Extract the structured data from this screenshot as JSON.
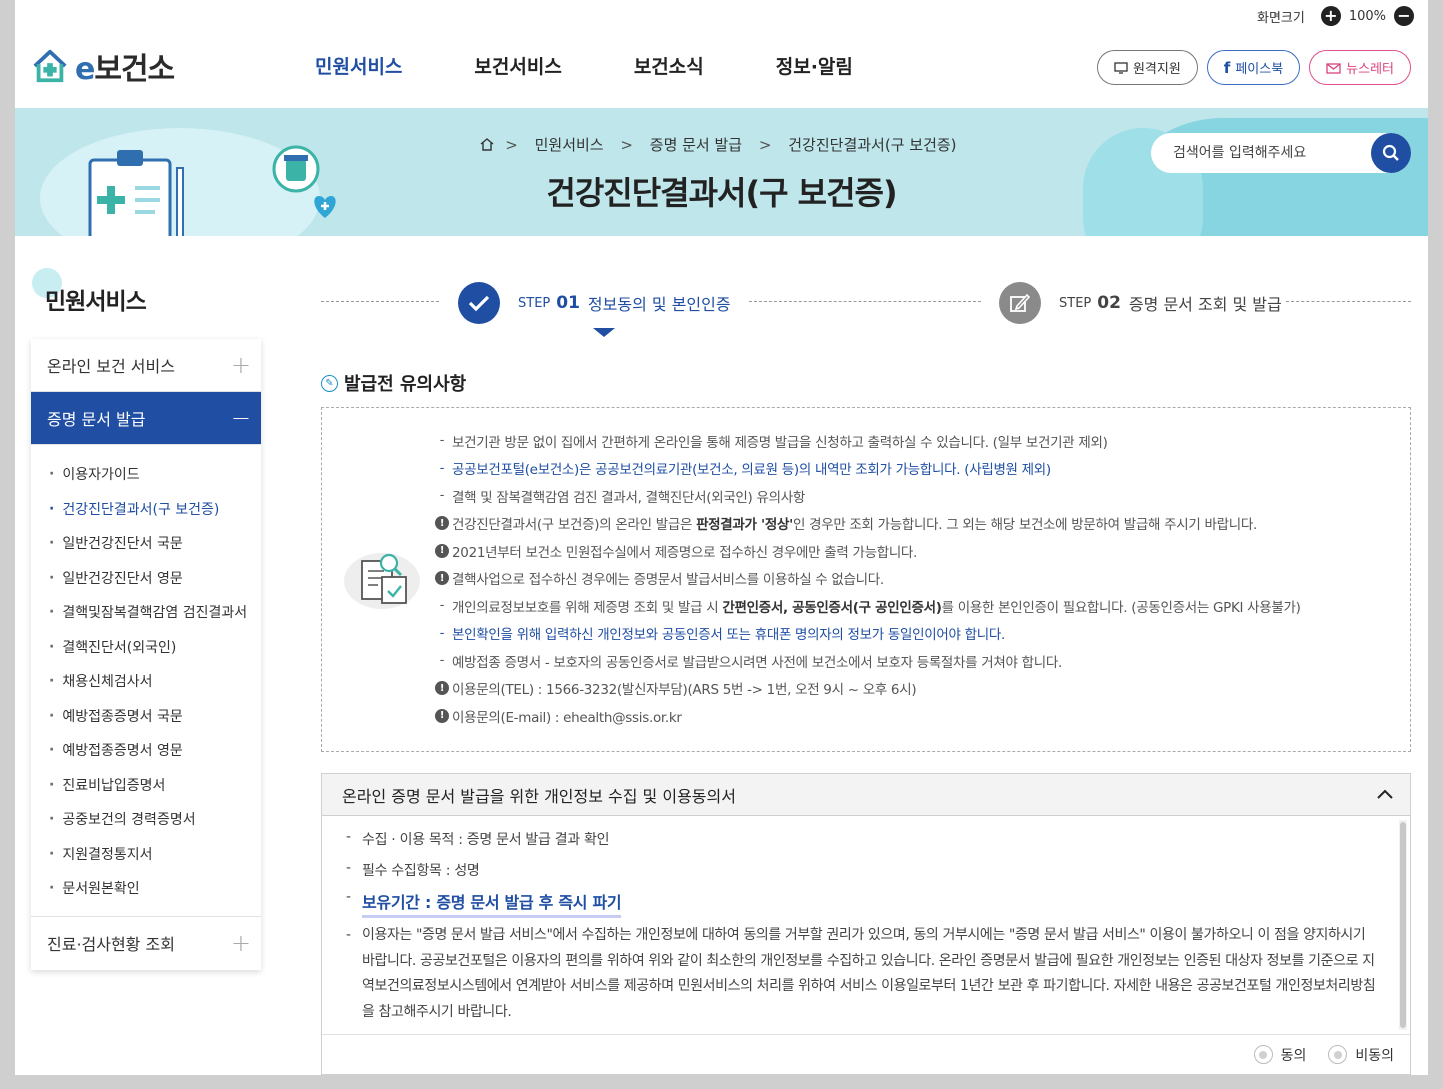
{
  "util": {
    "screen_size_label": "화면크기",
    "zoom": "100%",
    "plus": "+",
    "minus": "−"
  },
  "logo": {
    "e": "e",
    "text": "보건소"
  },
  "gnb": [
    "민원서비스",
    "보건서비스",
    "보건소식",
    "정보·알림"
  ],
  "header_buttons": {
    "remote": "원격지원",
    "facebook": "페이스북",
    "newsletter": "뉴스레터"
  },
  "breadcrumb": [
    "민원서비스",
    "증명 문서 발급",
    "건강진단결과서(구 보건증)"
  ],
  "page_title": "건강진단결과서(구 보건증)",
  "search": {
    "placeholder": "검색어를 입력해주세요"
  },
  "sidebar": {
    "title": "민원서비스",
    "menu": [
      {
        "label": "온라인 보건 서비스",
        "toggle": "+"
      },
      {
        "label": "증명 문서 발급",
        "toggle": "−"
      },
      {
        "label": "진료·검사현황 조회",
        "toggle": "+"
      }
    ],
    "sub": [
      "이용자가이드",
      "건강진단결과서(구 보건증)",
      "일반건강진단서 국문",
      "일반건강진단서 영문",
      "결핵및잠복결핵감염 검진결과서",
      "결핵진단서(외국인)",
      "채용신체검사서",
      "예방접종증명서 국문",
      "예방접종증명서 영문",
      "진료비납입증명서",
      "공중보건의 경력증명서",
      "지원결정통지서",
      "문서원본확인"
    ]
  },
  "steps": [
    {
      "label": "STEP",
      "num": "01",
      "title": "정보동의 및 본인인증"
    },
    {
      "label": "STEP",
      "num": "02",
      "title": "증명 문서 조회 및 발급"
    }
  ],
  "notice": {
    "title": "발급전 유의사항",
    "items": [
      "보건기관 방문 없이 집에서 간편하게 온라인을 통해 제증명 발급을 신청하고 출력하실 수 있습니다. (일부 보건기관 제외)",
      "공공보건포털(e보건소)은 공공보건의료기관(보건소, 의료원 등)의 내역만 조회가 가능합니다. (사립병원 제외)",
      "결핵 및 잠복결핵감염 검진 결과서, 결핵진단서(외국인) 유의사항",
      {
        "pre": "건강진단결과서(구 보건증)의 온라인 발급은 ",
        "bold": "판정결과가 '정상'",
        "post": "인 경우만 조회 가능합니다. 그 외는 해당 보건소에 방문하여 발급해 주시기 바랍니다."
      },
      "2021년부터 보건소 민원접수실에서 제증명으로 접수하신 경우에만 출력 가능합니다.",
      "결핵사업으로 접수하신 경우에는 증명문서 발급서비스를 이용하실 수 없습니다.",
      {
        "pre": "개인의료정보보호를 위해 제증명 조회 및 발급 시 ",
        "bold": "간편인증서, 공동인증서(구 공인인증서)",
        "post": "를 이용한 본인인증이 필요합니다. (공동인증서는 GPKI 사용불가)"
      },
      "본인확인을 위해 입력하신 개인정보와 공동인증서 또는 휴대폰 명의자의 정보가 동일인이어야 합니다.",
      "예방접종 증명서 - 보호자의 공동인증서로 발급받으시려면 사전에 보건소에서 보호자 등록절차를 거쳐야 합니다.",
      "이용문의(TEL) : 1566-3232(발신자부담)(ARS 5번 -> 1번, 오전 9시 ~ 오후 6시)",
      "이용문의(E-mail) : ehealth@ssis.or.kr"
    ]
  },
  "agreement": {
    "title": "온라인 증명 문서 발급을 위한 개인정보 수집 및 이용동의서",
    "purpose": "수집 · 이용 목적 : 증명 문서 발급 결과 확인",
    "items": "필수 수집항목 : 성명",
    "retention": "보유기간 : 증명 문서 발급 후 즉시 파기",
    "paragraph": "이용자는 \"증명 문서 발급 서비스\"에서 수집하는 개인정보에 대하여 동의를 거부할 권리가 있으며, 동의 거부시에는 \"증명 문서 발급 서비스\" 이용이 불가하오니 이 점을 양지하시기 바랍니다. 공공보건포털은 이용자의 편의를 위하여 위와 같이 최소한의 개인정보를 수집하고 있습니다. 온라인 증명문서 발급에 필요한 개인정보는 인증된 대상자 정보를 기준으로 지역보건의료정보시스템에서 연계받아 서비스를 제공하며 민원서비스의 처리를 위하여 서비스 이용일로부터 1년간 보관 후 파기합니다. 자세한 내용은 공공보건포털 개인정보처리방침을 참고해주시기 바랍니다.",
    "agree": "동의",
    "disagree": "비동의"
  },
  "colors": {
    "primary": "#1f4ea3",
    "banner": "#bfe6eb",
    "accent_pink": "#e24d8b"
  }
}
